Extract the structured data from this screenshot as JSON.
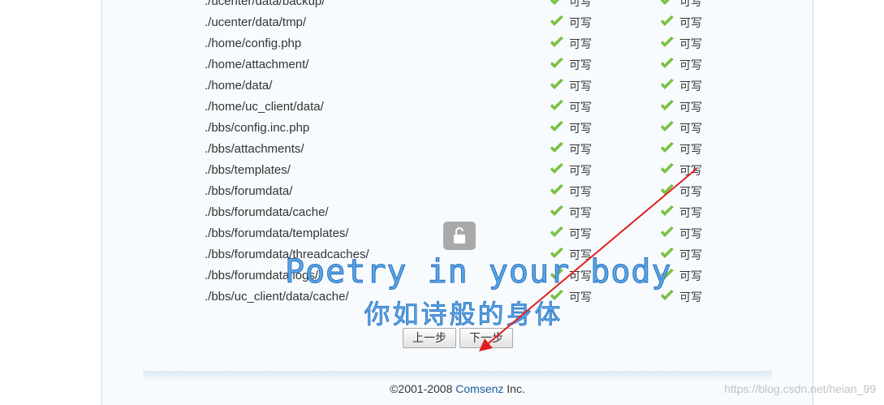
{
  "rows": [
    {
      "path": "./ucenter/data/backup/",
      "status1": "可写",
      "status2": "可写"
    },
    {
      "path": "./ucenter/data/tmp/",
      "status1": "可写",
      "status2": "可写"
    },
    {
      "path": "./home/config.php",
      "status1": "可写",
      "status2": "可写"
    },
    {
      "path": "./home/attachment/",
      "status1": "可写",
      "status2": "可写"
    },
    {
      "path": "./home/data/",
      "status1": "可写",
      "status2": "可写"
    },
    {
      "path": "./home/uc_client/data/",
      "status1": "可写",
      "status2": "可写"
    },
    {
      "path": "./bbs/config.inc.php",
      "status1": "可写",
      "status2": "可写"
    },
    {
      "path": "./bbs/attachments/",
      "status1": "可写",
      "status2": "可写"
    },
    {
      "path": "./bbs/templates/",
      "status1": "可写",
      "status2": "可写"
    },
    {
      "path": "./bbs/forumdata/",
      "status1": "可写",
      "status2": "可写"
    },
    {
      "path": "./bbs/forumdata/cache/",
      "status1": "可写",
      "status2": "可写"
    },
    {
      "path": "./bbs/forumdata/templates/",
      "status1": "可写",
      "status2": "可写"
    },
    {
      "path": "./bbs/forumdata/threadcaches/",
      "status1": "可写",
      "status2": "可写"
    },
    {
      "path": "./bbs/forumdata/logs/",
      "status1": "可写",
      "status2": "可写"
    },
    {
      "path": "./bbs/uc_client/data/cache/",
      "status1": "可写",
      "status2": "可写"
    }
  ],
  "icons": {
    "status": "check-icon",
    "lock": "unlock-icon"
  },
  "colors": {
    "check": "#7ac143",
    "arrow": "#e02020",
    "overlay_text": "#5aa7e6"
  },
  "overlay": {
    "english": "Poetry in your body",
    "chinese": "你如诗般的身体"
  },
  "buttons": {
    "prev": "上一步",
    "next": "下一步"
  },
  "footer": {
    "copyright": "©2001-2008 ",
    "company": "Comsenz",
    "suffix": " Inc."
  },
  "watermark": "https://blog.csdn.net/heian_99"
}
